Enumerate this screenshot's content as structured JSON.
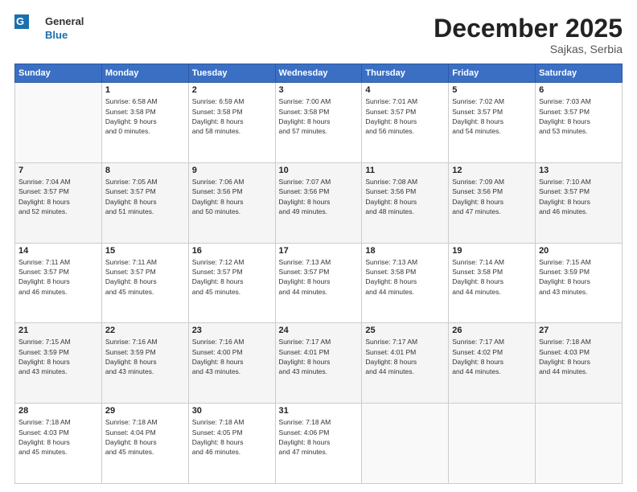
{
  "header": {
    "logo_line1": "General",
    "logo_line2": "Blue",
    "title": "December 2025",
    "subtitle": "Sajkas, Serbia"
  },
  "days_of_week": [
    "Sunday",
    "Monday",
    "Tuesday",
    "Wednesday",
    "Thursday",
    "Friday",
    "Saturday"
  ],
  "weeks": [
    [
      {
        "day": "",
        "info": ""
      },
      {
        "day": "1",
        "info": "Sunrise: 6:58 AM\nSunset: 3:58 PM\nDaylight: 9 hours\nand 0 minutes."
      },
      {
        "day": "2",
        "info": "Sunrise: 6:59 AM\nSunset: 3:58 PM\nDaylight: 8 hours\nand 58 minutes."
      },
      {
        "day": "3",
        "info": "Sunrise: 7:00 AM\nSunset: 3:58 PM\nDaylight: 8 hours\nand 57 minutes."
      },
      {
        "day": "4",
        "info": "Sunrise: 7:01 AM\nSunset: 3:57 PM\nDaylight: 8 hours\nand 56 minutes."
      },
      {
        "day": "5",
        "info": "Sunrise: 7:02 AM\nSunset: 3:57 PM\nDaylight: 8 hours\nand 54 minutes."
      },
      {
        "day": "6",
        "info": "Sunrise: 7:03 AM\nSunset: 3:57 PM\nDaylight: 8 hours\nand 53 minutes."
      }
    ],
    [
      {
        "day": "7",
        "info": "Sunrise: 7:04 AM\nSunset: 3:57 PM\nDaylight: 8 hours\nand 52 minutes."
      },
      {
        "day": "8",
        "info": "Sunrise: 7:05 AM\nSunset: 3:57 PM\nDaylight: 8 hours\nand 51 minutes."
      },
      {
        "day": "9",
        "info": "Sunrise: 7:06 AM\nSunset: 3:56 PM\nDaylight: 8 hours\nand 50 minutes."
      },
      {
        "day": "10",
        "info": "Sunrise: 7:07 AM\nSunset: 3:56 PM\nDaylight: 8 hours\nand 49 minutes."
      },
      {
        "day": "11",
        "info": "Sunrise: 7:08 AM\nSunset: 3:56 PM\nDaylight: 8 hours\nand 48 minutes."
      },
      {
        "day": "12",
        "info": "Sunrise: 7:09 AM\nSunset: 3:56 PM\nDaylight: 8 hours\nand 47 minutes."
      },
      {
        "day": "13",
        "info": "Sunrise: 7:10 AM\nSunset: 3:57 PM\nDaylight: 8 hours\nand 46 minutes."
      }
    ],
    [
      {
        "day": "14",
        "info": "Sunrise: 7:11 AM\nSunset: 3:57 PM\nDaylight: 8 hours\nand 46 minutes."
      },
      {
        "day": "15",
        "info": "Sunrise: 7:11 AM\nSunset: 3:57 PM\nDaylight: 8 hours\nand 45 minutes."
      },
      {
        "day": "16",
        "info": "Sunrise: 7:12 AM\nSunset: 3:57 PM\nDaylight: 8 hours\nand 45 minutes."
      },
      {
        "day": "17",
        "info": "Sunrise: 7:13 AM\nSunset: 3:57 PM\nDaylight: 8 hours\nand 44 minutes."
      },
      {
        "day": "18",
        "info": "Sunrise: 7:13 AM\nSunset: 3:58 PM\nDaylight: 8 hours\nand 44 minutes."
      },
      {
        "day": "19",
        "info": "Sunrise: 7:14 AM\nSunset: 3:58 PM\nDaylight: 8 hours\nand 44 minutes."
      },
      {
        "day": "20",
        "info": "Sunrise: 7:15 AM\nSunset: 3:59 PM\nDaylight: 8 hours\nand 43 minutes."
      }
    ],
    [
      {
        "day": "21",
        "info": "Sunrise: 7:15 AM\nSunset: 3:59 PM\nDaylight: 8 hours\nand 43 minutes."
      },
      {
        "day": "22",
        "info": "Sunrise: 7:16 AM\nSunset: 3:59 PM\nDaylight: 8 hours\nand 43 minutes."
      },
      {
        "day": "23",
        "info": "Sunrise: 7:16 AM\nSunset: 4:00 PM\nDaylight: 8 hours\nand 43 minutes."
      },
      {
        "day": "24",
        "info": "Sunrise: 7:17 AM\nSunset: 4:01 PM\nDaylight: 8 hours\nand 43 minutes."
      },
      {
        "day": "25",
        "info": "Sunrise: 7:17 AM\nSunset: 4:01 PM\nDaylight: 8 hours\nand 44 minutes."
      },
      {
        "day": "26",
        "info": "Sunrise: 7:17 AM\nSunset: 4:02 PM\nDaylight: 8 hours\nand 44 minutes."
      },
      {
        "day": "27",
        "info": "Sunrise: 7:18 AM\nSunset: 4:03 PM\nDaylight: 8 hours\nand 44 minutes."
      }
    ],
    [
      {
        "day": "28",
        "info": "Sunrise: 7:18 AM\nSunset: 4:03 PM\nDaylight: 8 hours\nand 45 minutes."
      },
      {
        "day": "29",
        "info": "Sunrise: 7:18 AM\nSunset: 4:04 PM\nDaylight: 8 hours\nand 45 minutes."
      },
      {
        "day": "30",
        "info": "Sunrise: 7:18 AM\nSunset: 4:05 PM\nDaylight: 8 hours\nand 46 minutes."
      },
      {
        "day": "31",
        "info": "Sunrise: 7:18 AM\nSunset: 4:06 PM\nDaylight: 8 hours\nand 47 minutes."
      },
      {
        "day": "",
        "info": ""
      },
      {
        "day": "",
        "info": ""
      },
      {
        "day": "",
        "info": ""
      }
    ]
  ]
}
